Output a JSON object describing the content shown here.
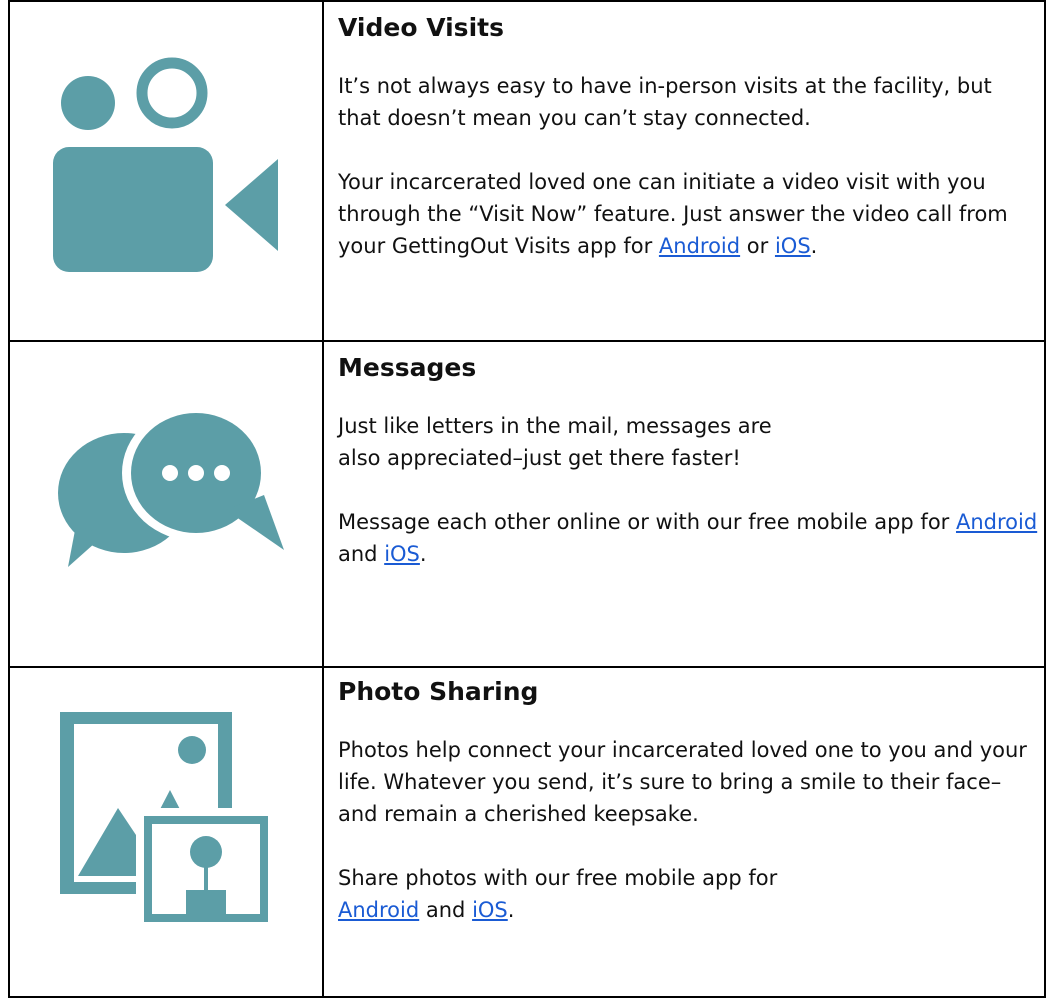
{
  "colors": {
    "icon": "#5c9ea7",
    "link": "#1a5bd4",
    "border": "#000000"
  },
  "rows": [
    {
      "icon": "video-camera-icon",
      "title": "Video Visits",
      "p1": "It’s not always easy to have in-person visits at the facility, but that doesn’t mean you can’t stay connected.",
      "p2_text": "Your incarcerated loved one can initiate a video visit with you through the “Visit Now” feature.  Just answer the video call from your GettingOut Visits app for ",
      "link1": "Android",
      "conj": " or ",
      "link2": "iOS",
      "end": "."
    },
    {
      "icon": "chat-bubbles-icon",
      "title": "Messages",
      "p1": "Just like letters in the mail, messages are also appreciated–just get there faster!",
      "p2_text": "Message each other online or with our free mobile app for ",
      "link1": "Android",
      "conj": " and ",
      "link2": "iOS",
      "end": "."
    },
    {
      "icon": "photo-sharing-icon",
      "title": "Photo Sharing",
      "p1": "Photos help connect your incarcerated loved one to you and your life. Whatever you send, it’s sure to bring a smile to their face–and remain a cherished keepsake.",
      "p2_text": "Share photos with our free mobile app for ",
      "link1": "Android",
      "conj": " and ",
      "link2": "iOS",
      "end": "."
    }
  ]
}
